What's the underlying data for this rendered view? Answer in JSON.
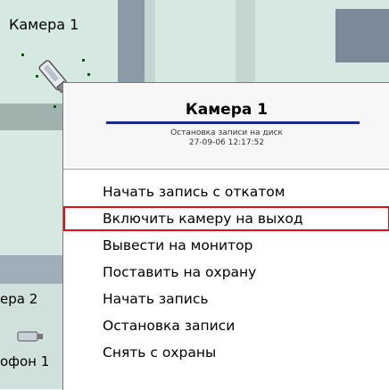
{
  "map": {
    "camera_label": "Камера 1",
    "side_labels": [
      "ера 2",
      "офон 1"
    ]
  },
  "menu": {
    "title": "Камера 1",
    "status_line1": "Остановка записи на диск",
    "status_line2": "27-09-06 12:17:52",
    "highlighted_index": 1,
    "items": [
      "Начать запись с откатом",
      "Включить камеру на выход",
      "Вывести на монитор",
      "Поставить на охрану",
      "Начать запись",
      "Остановка записи",
      "Снять с охраны"
    ]
  },
  "colors": {
    "highlight_border": "#e01010",
    "title_underline": "#1a2a8c",
    "map_background": "#d6e8e2"
  }
}
